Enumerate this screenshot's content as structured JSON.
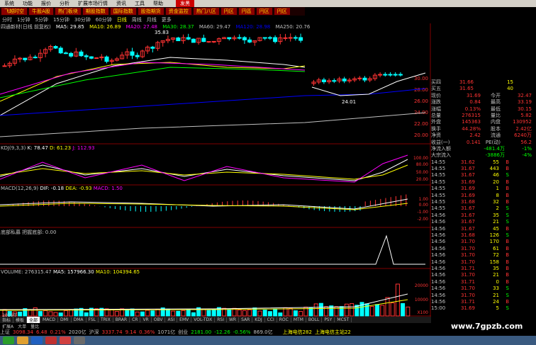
{
  "menu": [
    "系统",
    "功能",
    "报价",
    "分析",
    "扩展市场行情",
    "资讯",
    "工具",
    "帮助",
    "",
    "发黑"
  ],
  "toolbar": [
    "飞越时空",
    "牛股A股",
    "热门板块",
    "期股指数",
    "国际指数",
    "股指期货",
    "资金监控",
    "热门八区",
    "円区",
    "円區",
    "円区",
    "円区"
  ],
  "periods": [
    "分时",
    "1分钟",
    "5分钟",
    "15分钟",
    "30分钟",
    "60分钟",
    "日线",
    "周线",
    "月线",
    "更多"
  ],
  "main": {
    "stock": "四通新材(日线 前复权)",
    "ma5": "MA5: 29.85",
    "ma10": "MA10: 26.89",
    "ma20": "MA20: 27.48",
    "ma30": "MA30: 28.37",
    "ma60": "MA60: 29.47",
    "ma120": "MA120: 28.98",
    "ma250": "MA250: 20.76",
    "high_label": "35.83",
    "low_label": "24.01",
    "yaxis": [
      "30.00",
      "28.00",
      "26.00",
      "24.00",
      "22.00",
      "20.00"
    ]
  },
  "kdj": {
    "title": "KDJ(9,3,3)",
    "k": "K: 78.47",
    "d": "D: 61.23",
    "j": "J: 112.93",
    "yaxis": [
      "100.00",
      "80.00",
      "50.00",
      "20.00"
    ]
  },
  "macd": {
    "title": "MACD(12,26,9)",
    "dif": "DIF: -0.18",
    "dea": "DEA: -0.93",
    "macd": "MACD: 1.50",
    "yaxis": [
      "1.00",
      "0.00",
      "-1.00",
      "-2.00"
    ]
  },
  "bottom_fish": {
    "title": "底部私募 把握底部: 0.00"
  },
  "volume": {
    "title": "VOLUME: 276315.47",
    "ma5": "MA5: 157966.30",
    "ma10": "MA10: 104394.65",
    "yaxis": [
      "20000",
      "10000",
      "X100"
    ],
    "year": "2016年"
  },
  "quote": {
    "buy_rows": [
      {
        "label": "买四",
        "price": "31.66",
        "vol": "15"
      },
      {
        "label": "买五",
        "price": "31.65",
        "vol": "40"
      }
    ],
    "info_rows": [
      {
        "l1": "现价",
        "v1": "31.69",
        "l2": "今开",
        "v2": "32.47"
      },
      {
        "l1": "涨跌",
        "v1": "0.84",
        "l2": "最高",
        "v2": "33.19"
      },
      {
        "l1": "涨幅",
        "v1": "0.13%",
        "l2": "最低",
        "v2": "30.15"
      },
      {
        "l1": "总量",
        "v1": "276315",
        "l2": "量比",
        "v2": "5.82"
      },
      {
        "l1": "外盘",
        "v1": "145363",
        "l2": "内盘",
        "v2": "130952"
      },
      {
        "l1": "换手",
        "v1": "44.28%",
        "l2": "股本",
        "v2": "2.42亿"
      },
      {
        "l1": "净资",
        "v1": "2.42",
        "l2": "流通",
        "v2": "6240万"
      },
      {
        "l1": "收益(一)",
        "v1": "0.141",
        "l2": "PE(动)",
        "v2": "56.2"
      }
    ],
    "flow": [
      {
        "label": "净流入额",
        "value": "-481.4万",
        "pct": "-1%"
      },
      {
        "label": "大宗流入",
        "value": "-3886万",
        "pct": "-4%"
      }
    ],
    "ticks": [
      {
        "t": "14:55",
        "p": "31.62",
        "v": "55",
        "s": "B"
      },
      {
        "t": "14:55",
        "p": "31.67",
        "v": "443",
        "s": "B"
      },
      {
        "t": "14:55",
        "p": "31.67",
        "v": "46",
        "s": "S"
      },
      {
        "t": "14:55",
        "p": "31.69",
        "v": "20",
        "s": "B"
      },
      {
        "t": "14:55",
        "p": "31.69",
        "v": "1",
        "s": "B"
      },
      {
        "t": "14:55",
        "p": "31.69",
        "v": "8",
        "s": "B"
      },
      {
        "t": "14:55",
        "p": "31.68",
        "v": "32",
        "s": "B"
      },
      {
        "t": "14:55",
        "p": "31.67",
        "v": "2",
        "s": "S"
      },
      {
        "t": "14:56",
        "p": "31.67",
        "v": "35",
        "s": "S"
      },
      {
        "t": "14:56",
        "p": "31.67",
        "v": "21",
        "s": "S"
      },
      {
        "t": "14:56",
        "p": "31.67",
        "v": "45",
        "s": "B"
      },
      {
        "t": "14:56",
        "p": "31.68",
        "v": "126",
        "s": "S"
      },
      {
        "t": "14:56",
        "p": "31.70",
        "v": "170",
        "s": "B"
      },
      {
        "t": "14:56",
        "p": "31.70",
        "v": "61",
        "s": "B"
      },
      {
        "t": "14:56",
        "p": "31.70",
        "v": "72",
        "s": "B"
      },
      {
        "t": "14:56",
        "p": "31.70",
        "v": "158",
        "s": "B"
      },
      {
        "t": "14:56",
        "p": "31.71",
        "v": "35",
        "s": "B"
      },
      {
        "t": "14:56",
        "p": "31.70",
        "v": "21",
        "s": "B"
      },
      {
        "t": "14:56",
        "p": "31.71",
        "v": "0",
        "s": "B"
      },
      {
        "t": "14:56",
        "p": "31.70",
        "v": "33",
        "s": "S"
      },
      {
        "t": "14:56",
        "p": "31.70",
        "v": "21",
        "s": "S"
      },
      {
        "t": "14:56",
        "p": "31.71",
        "v": "24",
        "s": "B"
      },
      {
        "t": "15:00",
        "p": "31.69",
        "v": "5",
        "s": "S"
      }
    ]
  },
  "bottom_tabs": [
    "指标",
    "模板",
    "全部",
    "MACD",
    "DMI",
    "DMA",
    "FSL",
    "TRIX",
    "BRAR",
    "CR",
    "VR",
    "OBV",
    "ASI",
    "EMV",
    "VOL-TDX",
    "RSI",
    "WR",
    "SAR",
    "KDJ",
    "CCI",
    "ROC",
    "MTM",
    "BOLL",
    "PSY",
    "MCST"
  ],
  "bottom_tabs2": [
    "扩展A",
    "大单",
    "量比"
  ],
  "status": {
    "sh_label": "上证",
    "sh_val": "3098.34",
    "sh_chg": "6.48",
    "sh_pct": "0.21%",
    "sh_amt": "2020亿",
    "sz_label": "沪深",
    "sz_val": "3337.74",
    "sz_chg": "9.14",
    "sz_pct": "0.36%",
    "sz_amt": "1071亿",
    "cy_label": "创业",
    "cy_val": "2181.00",
    "cy_chg": "-12.26",
    "cy_pct": "-0.56%",
    "cy_amt": "869.0亿",
    "srv1": "上海电信282",
    "srv2": "上海电信主站22"
  },
  "watermark": "www.7gpzb.com",
  "colors": {
    "up": "#ff3333",
    "down": "#00ffff",
    "ma5": "#ffffff",
    "ma10": "#ffff00",
    "ma20": "#ff00ff",
    "ma30": "#00ff00",
    "ma60": "#c0c0c0",
    "ma250": "#0000ff",
    "grid": "#800000"
  }
}
